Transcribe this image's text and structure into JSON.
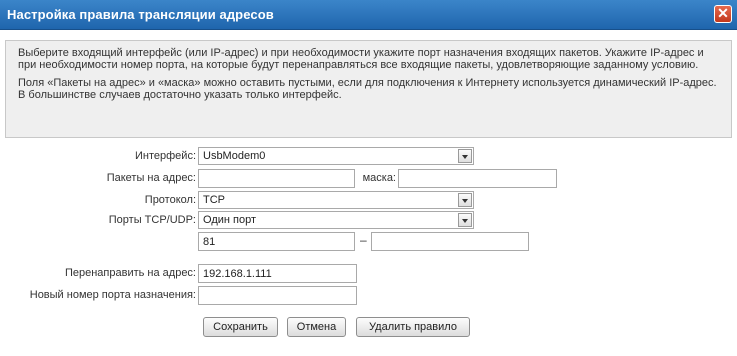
{
  "dialog": {
    "title": "Настройка правила трансляции адресов",
    "close_glyph": "✕"
  },
  "info": {
    "paragraph1": "Выберите входящий интерфейс (или IP-адрес) и при необходимости укажите порт назначения входящих пакетов. Укажите IP-адрес и при необходимости номер порта, на которые будут перенаправляться все входящие пакеты, удовлетворяющие заданному условию.",
    "paragraph2": "Поля «Пакеты на адрес» и «маска» можно оставить пустыми, если для подключения к Интернету используется динамический IP-адрес. В большинстве случаев достаточно указать только интерфейс."
  },
  "form": {
    "interface": {
      "label": "Интерфейс:",
      "value": "UsbModem0"
    },
    "packets_to": {
      "label": "Пакеты на адрес:",
      "value": ""
    },
    "mask": {
      "label": "маска:",
      "value": ""
    },
    "protocol": {
      "label": "Протокол:",
      "value": "TCP"
    },
    "ports": {
      "label": "Порты TCP/UDP:",
      "value": "Один порт"
    },
    "port_from": {
      "value": "81"
    },
    "port_separator": "–",
    "port_to": {
      "value": ""
    },
    "redirect_to": {
      "label": "Перенаправить на адрес:",
      "value": "192.168.1.111"
    },
    "new_port": {
      "label": "Новый номер порта назначения:",
      "value": ""
    }
  },
  "buttons": {
    "save": "Сохранить",
    "cancel": "Отмена",
    "delete": "Удалить правило"
  }
}
